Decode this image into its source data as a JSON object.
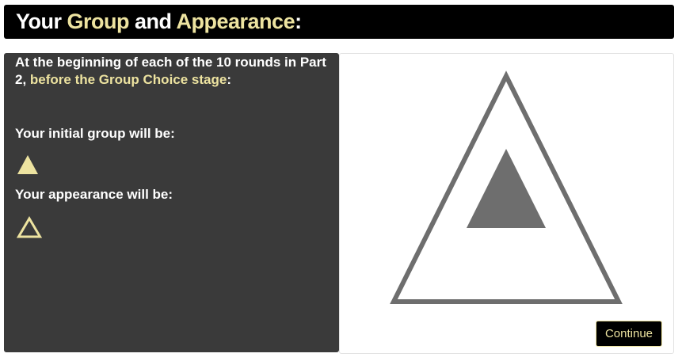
{
  "header": {
    "title_part1": "Your ",
    "title_group": "Group",
    "title_and": " and ",
    "title_appearance": "Appearance",
    "title_colon": ":"
  },
  "left_panel": {
    "intro_text": "At the beginning of each of the 10 rounds in Part 2, ",
    "intro_highlight": "before the Group Choice stage",
    "intro_colon": ":",
    "initial_group_label": "Your initial group will be:",
    "initial_group_icon": "filled-triangle-icon",
    "appearance_label": "Your appearance will be:",
    "appearance_icon": "outline-triangle-icon"
  },
  "right_panel": {
    "graphic": "outline-triangle-with-filled-triangle-icon",
    "continue_label": "Continue"
  },
  "colors": {
    "accent": "#ede3a0",
    "panel_dark": "#3a3a3a",
    "graphic_gray": "#6e6e6e",
    "header_bg": "#000000"
  }
}
